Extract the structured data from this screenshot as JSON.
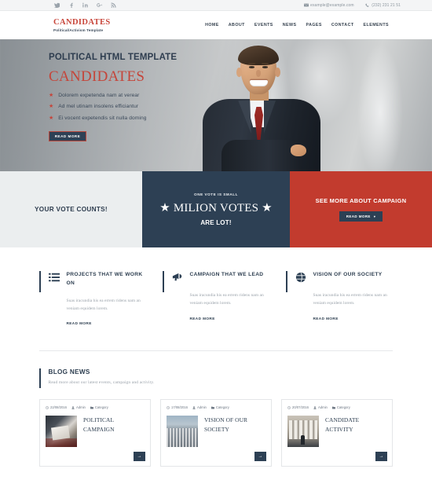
{
  "topbar": {
    "social": [
      {
        "name": "twitter-icon",
        "label": "Twitter"
      },
      {
        "name": "facebook-icon",
        "label": "Facebook"
      },
      {
        "name": "linkedin-icon",
        "label": "LinkedIn"
      },
      {
        "name": "google-plus-icon",
        "label": "Google Plus"
      },
      {
        "name": "rss-icon",
        "label": "RSS"
      }
    ],
    "email": "example@example.com",
    "phone": "(232) 231 21 51"
  },
  "header": {
    "logo": "CANDIDATES",
    "logo_sub": "Political/Activism Template",
    "nav": [
      {
        "label": "HOME"
      },
      {
        "label": "ABOUT"
      },
      {
        "label": "EVENTS"
      },
      {
        "label": "NEWS"
      },
      {
        "label": "PAGES"
      },
      {
        "label": "CONTACT"
      },
      {
        "label": "ELEMENTS"
      }
    ]
  },
  "hero": {
    "kicker": "POLITICAL HTML TEMPLATE",
    "title": "CANDIDATES",
    "bullets": [
      "Dolorem expetenda nam at verear",
      "Ad mel utinam insolens efficiantur",
      "Ei vocent expetendis sit nulla doming"
    ],
    "button": "READ MORE"
  },
  "banner": {
    "left_text": "YOUR VOTE COUNTS!",
    "mid_small": "ONE VOTE IS SMALL",
    "mid_big": "★ MILION VOTES ★",
    "mid_sub": "ARE LOT!",
    "right_heading": "SEE MORE ABOUT CAMPAIGN",
    "right_button": "READ MORE"
  },
  "features": [
    {
      "icon": "list-icon",
      "title": "PROJECTS THAT WE WORK ON",
      "body": "Suas iracundia his ea errem ridens nam an veniam equidem lorem.",
      "link": "READ MORE"
    },
    {
      "icon": "megaphone-icon",
      "title": "CAMPAIGN THAT WE LEAD",
      "body": "Suas iracundia his ea errem ridens nam an veniam equidem lorem.",
      "link": "READ MORE"
    },
    {
      "icon": "globe-icon",
      "title": "VISION OF OUR SOCIETY",
      "body": "Suas iracundia his ea errem ridens nam an veniam equidem lorem.",
      "link": "READ MORE"
    }
  ],
  "blog": {
    "heading": "BLOG NEWS",
    "subheading": "Read more about our latest events, campaign and activity.",
    "cards": [
      {
        "date": "22/08/2016",
        "author": "Admin",
        "category": "Category",
        "title": "POLITICAL CAMPAIGN",
        "arrow": "→",
        "thumb": "handshake-document-photo"
      },
      {
        "date": "17/08/2016",
        "author": "Admin",
        "category": "Category",
        "title": "VISION OF OUR SOCIETY",
        "arrow": "→",
        "thumb": "cityscape-photo"
      },
      {
        "date": "20/07/2016",
        "author": "Admin",
        "category": "Category",
        "title": "CANDIDATE ACTIVITY",
        "arrow": "→",
        "thumb": "government-building-photo"
      }
    ]
  },
  "colors": {
    "accent_red": "#c23b2e",
    "navy": "#2d4054",
    "light_gray": "#ebeeef",
    "muted_text": "#9ba3ab"
  }
}
